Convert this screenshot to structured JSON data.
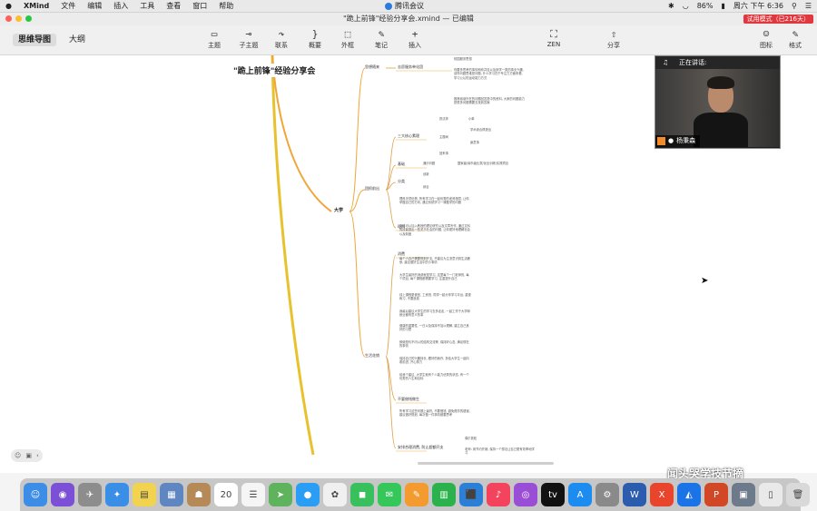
{
  "menubar": {
    "apple": "",
    "app_name": "XMind",
    "menus": [
      "文件",
      "编辑",
      "插入",
      "工具",
      "查看",
      "窗口",
      "帮助"
    ],
    "center_app": "腾讯会议",
    "battery": "86%",
    "clock": "周六 下午 6:36"
  },
  "window": {
    "title": "\"跪上前锋\"经验分享会.xmind — 已编辑",
    "trial_badge": "试用模式（已216天）"
  },
  "toolbar": {
    "view_tabs": [
      "思维导图",
      "大纲"
    ],
    "tools": [
      {
        "icon": "topic-icon",
        "glyph": "▭",
        "label": "主题"
      },
      {
        "icon": "subtopic-icon",
        "glyph": "⊸",
        "label": "子主题"
      },
      {
        "icon": "relationship-icon",
        "glyph": "↷",
        "label": "联系"
      },
      {
        "icon": "summary-icon",
        "glyph": "}",
        "label": "概要"
      },
      {
        "icon": "boundary-icon",
        "glyph": "⬚",
        "label": "外框"
      },
      {
        "icon": "notes-icon",
        "glyph": "✎",
        "label": "笔记"
      },
      {
        "icon": "insert-icon",
        "glyph": "+",
        "label": "插入"
      }
    ],
    "zen_label": "ZEN",
    "share_label": "分享",
    "icons_label": "图标",
    "format_label": "格式"
  },
  "mindmap": {
    "central_topic": "\"跪上前锋\"经验分享会",
    "main_branch": "大学",
    "branches": [
      {
        "label": "思想随来",
        "subs": [
          {
            "label": "志愿服务单化团",
            "notes": [
              "校园服务思想",
              "你要多思考的事情和你并自以及到学一类的事业兴趣, 该样问题思维是问题, 什么学习在于专注力方面来看, 学习公认的运动能力方式",
              "推荐阅读外在的问题回答是中的资料, 大家的问题能力是很多问题需要去找到答案"
            ]
          }
        ]
      },
      {
        "label": "团抓前出",
        "subs": [
          {
            "label": "三大核心素理",
            "notes": [
              "抓法拌",
              "小单",
              "主题间",
              "学术综合得提出",
              "赢意事",
              "回来事"
            ]
          },
          {
            "label": "基础",
            "notes": [
              "通识问题",
              "国家级/省市级比赛/创业训练/实践项目"
            ]
          },
          {
            "label": "分类",
            "notes": [
              "创新",
              "综合"
            ]
          },
          {
            "label": "理科",
            "notes": [
              "理科天然优势, 所有学习在一起优秀的老师指导, 让你掌握自己的方向, 通过系统学习一课做学的问题",
              "文科可以加入教授的理论研究以及文章写作, 通过文科的技能提出一些关于社会的问题, 让你更好地理解社会以及制度"
            ]
          }
        ]
      },
      {
        "label": "生活花销",
        "subs": [
          {
            "label": "消费",
            "notes": [
              "每个人自己需要规划开支, 不建议为主流意识到生活奢侈, 建议做好生活中的小事情",
              "大学生最好的消费就是学习, 这里每个一门老师的, 每个项目, 每个课程都需要学习, 注重提升自己",
              "线上课程更便宜, 工资低, 同学一起分享学习平台, 重视练习, 不要浪费",
              "我最后建议大学生的学习去多走走, 一起工作于大学和就业都有意义的事",
              "健康的重要性, 一日以及保持不加以理解, 建立自己良好的习惯",
              "即使是约不问以的结构交流等, 保持好心态, 满足现在的事情",
              "保持自己的兴趣特长, 跟好的我作, 多给大学生一起向着前进, 开心努力",
              "给我个建议, 大学生就有个人能力优秀的状态, 有一个优秀的人生和目标"
            ]
          },
          {
            "label": "不要借钱做生",
            "notes": [
              "所有学习这些问题上最热, 不要借钱, 避免借贷的错误, 建议做好规划, 每次做一件事情都要思考"
            ]
          },
          {
            "label": "安排合理消费, 防止超额开支",
            "notes": [
              "偶尔放松",
              "老师: 用节约开销, 保持一个想法让自己更有效率地学习"
            ]
          }
        ]
      }
    ]
  },
  "video": {
    "speaking_label": "正在讲话:",
    "speaker_name": "杨秉森"
  },
  "watermark": "闻头哭学技节摘",
  "dock": {
    "icons": [
      {
        "name": "finder-icon",
        "color": "#3b8de6",
        "glyph": "☺"
      },
      {
        "name": "siri-icon",
        "color": "#7b4fd6",
        "glyph": "◉"
      },
      {
        "name": "launchpad-icon",
        "color": "#8d8d8d",
        "glyph": "✈"
      },
      {
        "name": "safari-icon",
        "color": "#3a8ee6",
        "glyph": "✦"
      },
      {
        "name": "notes-app-icon",
        "color": "#f2d34f",
        "glyph": "▤"
      },
      {
        "name": "preview-icon",
        "color": "#5f86c0",
        "glyph": "▦"
      },
      {
        "name": "contacts-icon",
        "color": "#b58a56",
        "glyph": "☗"
      },
      {
        "name": "calendar-icon",
        "color": "#ffffff",
        "glyph": "20"
      },
      {
        "name": "reminders-icon",
        "color": "#f5f5f5",
        "glyph": "☰"
      },
      {
        "name": "maps-icon",
        "color": "#5fb35c",
        "glyph": "➤"
      },
      {
        "name": "messages-bubble-icon",
        "color": "#2a9df4",
        "glyph": "●"
      },
      {
        "name": "photos-icon",
        "color": "#f0f0f0",
        "glyph": "✿"
      },
      {
        "name": "facetime-icon",
        "color": "#37c05b",
        "glyph": "◼"
      },
      {
        "name": "messages-icon",
        "color": "#35c759",
        "glyph": "✉"
      },
      {
        "name": "pages-icon",
        "color": "#f39b2f",
        "glyph": "✎"
      },
      {
        "name": "numbers-icon",
        "color": "#2bb24c",
        "glyph": "▥"
      },
      {
        "name": "keynote-icon",
        "color": "#2c7fd6",
        "glyph": "⬛"
      },
      {
        "name": "music-icon",
        "color": "#f4435c",
        "glyph": "♪"
      },
      {
        "name": "podcasts-icon",
        "color": "#9a4ed6",
        "glyph": "◎"
      },
      {
        "name": "tv-icon",
        "color": "#111111",
        "glyph": "tv"
      },
      {
        "name": "app-store-icon",
        "color": "#1d8cf0",
        "glyph": "A"
      },
      {
        "name": "system-preferences-icon",
        "color": "#8a8a8a",
        "glyph": "⚙"
      },
      {
        "name": "word-icon",
        "color": "#2b5cad",
        "glyph": "W"
      },
      {
        "name": "xmind-icon",
        "color": "#e8452c",
        "glyph": "X"
      },
      {
        "name": "tencent-meeting-icon",
        "color": "#1b73e8",
        "glyph": "◭"
      },
      {
        "name": "powerpoint-icon",
        "color": "#d24726",
        "glyph": "P"
      },
      {
        "name": "screenshot-icon",
        "color": "#6c7a8c",
        "glyph": "▣"
      },
      {
        "name": "documents-icon",
        "color": "#e9e9e9",
        "glyph": "▯"
      },
      {
        "name": "trash-icon",
        "color": "#d9d9d9",
        "glyph": "🗑"
      }
    ]
  }
}
